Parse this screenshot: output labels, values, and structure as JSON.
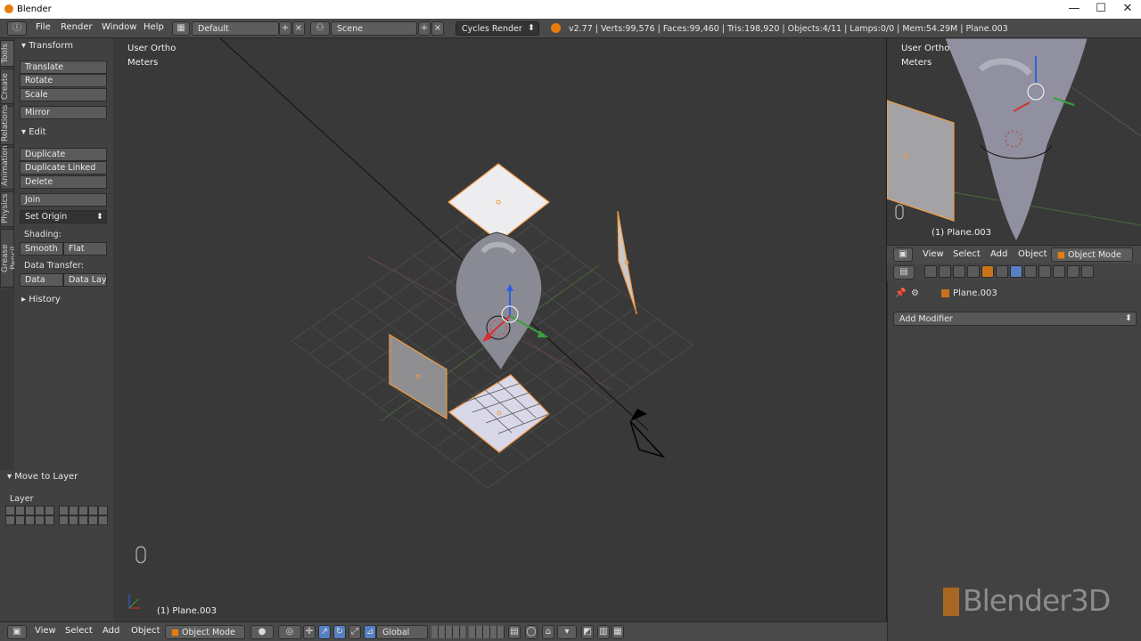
{
  "window": {
    "title": "Blender"
  },
  "menu": {
    "items": [
      "File",
      "Render",
      "Window",
      "Help"
    ],
    "screen_layout": "Default",
    "scene": "Scene",
    "render_engine": "Cycles Render"
  },
  "stats": "v2.77 | Verts:99,576 | Faces:99,460 | Tris:198,920 | Objects:4/11 | Lamps:0/0 | Mem:54.29M | Plane.003",
  "tool_tabs": [
    "Tools",
    "Create",
    "Relations",
    "Animation",
    "Physics",
    "Grease Pencil"
  ],
  "toolshelf": {
    "transform": {
      "header": "Transform",
      "buttons": [
        "Translate",
        "Rotate",
        "Scale",
        "Mirror"
      ]
    },
    "edit": {
      "header": "Edit",
      "buttons": [
        "Duplicate",
        "Duplicate Linked",
        "Delete",
        "Join"
      ],
      "set_origin": "Set Origin",
      "shading_label": "Shading:",
      "smooth": "Smooth",
      "flat": "Flat",
      "data_transfer_label": "Data Transfer:",
      "data": "Data",
      "data_layo": "Data Layo"
    },
    "history": "History"
  },
  "move_to_layer": {
    "header": "Move to Layer",
    "layer_label": "Layer"
  },
  "viewport": {
    "view_name": "User Ortho",
    "units": "Meters",
    "object_label": "(1) Plane.003"
  },
  "right_view": {
    "view_name": "User Ortho",
    "units": "Meters",
    "object_label": "(1) Plane.003"
  },
  "bottom_bar": {
    "view": "View",
    "select": "Select",
    "add": "Add",
    "object": "Object",
    "mode": "Object Mode",
    "orientation": "Global"
  },
  "right_header": {
    "view": "View",
    "select": "Select",
    "add": "Add",
    "object": "Object",
    "mode": "Object Mode"
  },
  "properties": {
    "object_name": "Plane.003",
    "add_modifier": "Add Modifier"
  },
  "watermark": "Blender3D",
  "colors": {
    "accent_orange": "#e87d0d",
    "selection_outline": "#f39b45",
    "grid_line": "#4c4c4c",
    "active_tab": "#5680c2"
  }
}
